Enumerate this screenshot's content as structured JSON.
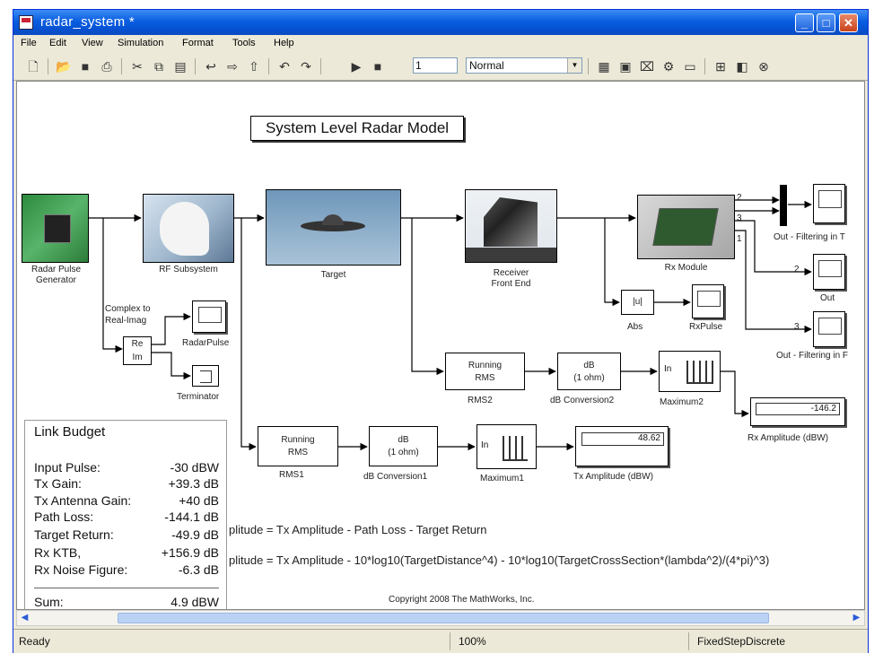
{
  "window": {
    "title": "radar_system *"
  },
  "menu": [
    "File",
    "Edit",
    "View",
    "Simulation",
    "Format",
    "Tools",
    "Help"
  ],
  "toolbar": {
    "stop_time": "1",
    "sim_mode": "Normal",
    "icons": [
      "new-icon",
      "open-icon",
      "save-icon",
      "print-icon",
      "cut-icon",
      "copy-icon",
      "paste-icon",
      "undo-icon",
      "redo-icon",
      "up-icon",
      "rotate-icon",
      "rotate-back-icon",
      "play-icon",
      "stop-icon",
      "library-icon",
      "model-explorer-icon",
      "debugger-icon",
      "signal-icon",
      "build-icon",
      "subsystem-icon",
      "diagnostics-icon",
      "help-icon"
    ]
  },
  "model": {
    "title": "System Level Radar Model",
    "blocks": {
      "radar_pulse": "Radar Pulse",
      "radar_pulse_2": "Generator",
      "rf_subsystem": "RF Subsystem",
      "target": "Target",
      "receiver": "Receiver",
      "receiver_2": "Front End",
      "rx_module": "Rx Module",
      "out_filtering_1": "Out - Filtering in T",
      "out": "Out",
      "out_filtering_2": "Out - Filtering in F",
      "complex_to": "Complex to",
      "real_imag": "Real-Imag",
      "re": "Re",
      "im": "Im",
      "radar_pulse_scope": "RadarPulse",
      "terminator": "Terminator",
      "abs_symbol": "|u|",
      "abs": "Abs",
      "rx_pulse": "RxPulse",
      "running": "Running",
      "rms": "RMS",
      "rms2": "RMS2",
      "db": "dB",
      "one_ohm": "(1 ohm)",
      "db_conversion2": "dB Conversion2",
      "in": "In",
      "maximum2": "Maximum2",
      "rx_amp_value": "-146.2",
      "rx_amp": "Rx Amplitude (dBW)",
      "rms1": "RMS1",
      "db_conversion1": "dB Conversion1",
      "maximum1": "Maximum1",
      "tx_amp_value": "48.62",
      "tx_amp": "Tx Amplitude (dBW)",
      "port_2": "2",
      "port_3": "3",
      "port_1": "1"
    }
  },
  "link_budget": {
    "title": "Link Budget",
    "rows": [
      {
        "label": "Input Pulse:",
        "value": "-30 dBW"
      },
      {
        "label": "Tx Gain:",
        "value": "+39.3 dB"
      },
      {
        "label": "Tx Antenna Gain:",
        "value": "+40 dB"
      },
      {
        "label": "Path Loss:",
        "value": "-144.1 dB"
      },
      {
        "label": "Target Return:",
        "value": "-49.9 dB"
      },
      {
        "label": "Rx KTB,",
        "value": "+156.9 dB"
      },
      {
        "label": "Rx Noise Figure:",
        "value": "-6.3 dB"
      }
    ],
    "sum_label": "Sum:",
    "sum_value": "4.9 dBW"
  },
  "equations": {
    "eq1": "plitude = Tx Amplitude - Path Loss - Target Return",
    "eq2": "plitude = Tx Amplitude - 10*log10(TargetDistance^4) - 10*log10(TargetCrossSection*(lambda^2)/(4*pi)^3)",
    "copyright": "Copyright 2008 The MathWorks, Inc."
  },
  "status": {
    "ready": "Ready",
    "zoom": "100%",
    "solver": "FixedStepDiscrete"
  }
}
